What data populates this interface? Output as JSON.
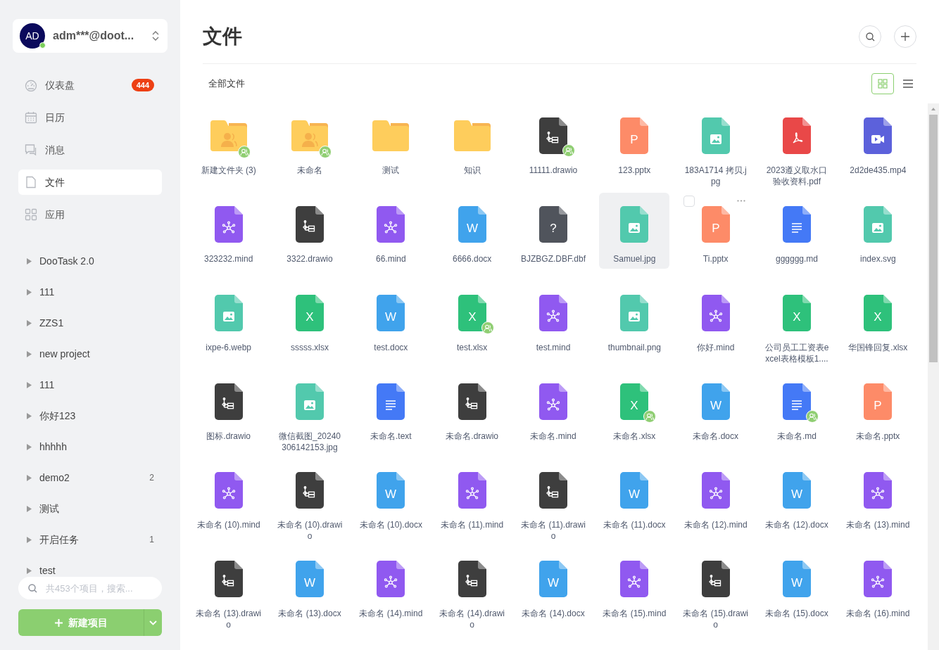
{
  "sidebar": {
    "user": {
      "avatar": "AD",
      "name": "adm***@doot...",
      "online": true
    },
    "nav": [
      {
        "kind": "dashboard",
        "label": "仪表盘",
        "badge": "444",
        "selected": false
      },
      {
        "kind": "calendar",
        "label": "日历",
        "selected": false
      },
      {
        "kind": "message",
        "label": "消息",
        "selected": false
      },
      {
        "kind": "file",
        "label": "文件",
        "selected": true
      },
      {
        "kind": "apps",
        "label": "应用",
        "selected": false
      }
    ],
    "projects": [
      {
        "name": "DooTask 2.0"
      },
      {
        "name": "111"
      },
      {
        "name": "ZZS1"
      },
      {
        "name": "new project"
      },
      {
        "name": "111"
      },
      {
        "name": "你好123"
      },
      {
        "name": "hhhhh"
      },
      {
        "name": "demo2",
        "count": "2"
      },
      {
        "name": "测试"
      },
      {
        "name": "开启任务",
        "count": "1"
      },
      {
        "name": "test"
      }
    ],
    "search": {
      "placeholder": "共453个项目，搜索..."
    },
    "new_button": "新建项目"
  },
  "main": {
    "title": "文件",
    "breadcrumb": "全部文件",
    "view_modes": [
      {
        "kind": "grid",
        "selected": true
      },
      {
        "kind": "list",
        "selected": false
      }
    ],
    "files": [
      {
        "name": "新建文件夹 (3)",
        "kind": "folder",
        "shared": true,
        "selected": false,
        "hovered": false
      },
      {
        "name": "未命名",
        "kind": "folder",
        "shared": true,
        "selected": false,
        "hovered": false
      },
      {
        "name": "测试",
        "kind": "folder",
        "shared": false,
        "selected": false,
        "hovered": false
      },
      {
        "name": "知识",
        "kind": "folder",
        "shared": false,
        "selected": false,
        "hovered": false
      },
      {
        "name": "11111.drawio",
        "kind": "drawio",
        "shared": true,
        "selected": false,
        "hovered": false
      },
      {
        "name": "123.pptx",
        "kind": "pptx",
        "glyph": "P",
        "shared": false,
        "selected": false,
        "hovered": false
      },
      {
        "name": "183A1714 拷贝.jpg",
        "kind": "image",
        "shared": false,
        "selected": false,
        "hovered": false
      },
      {
        "name": "2023遵义取水口验收资料.pdf",
        "kind": "pdf",
        "shared": false,
        "selected": false,
        "hovered": false
      },
      {
        "name": "2d2de435.mp4",
        "kind": "video",
        "shared": false,
        "selected": false,
        "hovered": false
      },
      {
        "name": "323232.mind",
        "kind": "mind",
        "shared": false,
        "selected": false,
        "hovered": false
      },
      {
        "name": "3322.drawio",
        "kind": "drawio",
        "shared": false,
        "selected": false,
        "hovered": false
      },
      {
        "name": "66.mind",
        "kind": "mind",
        "shared": false,
        "selected": false,
        "hovered": false
      },
      {
        "name": "6666.docx",
        "kind": "docx",
        "glyph": "W",
        "shared": false,
        "selected": false,
        "hovered": false
      },
      {
        "name": "BJZBGZ.DBF.dbf",
        "kind": "unknown",
        "glyph": "?",
        "shared": false,
        "selected": false,
        "hovered": false
      },
      {
        "name": "Samuel.jpg",
        "kind": "image",
        "shared": false,
        "selected": true,
        "hovered": false
      },
      {
        "name": "Ti.pptx",
        "kind": "pptx",
        "glyph": "P",
        "shared": false,
        "selected": false,
        "hovered": true
      },
      {
        "name": "gggggg.md",
        "kind": "md",
        "shared": false,
        "selected": false,
        "hovered": false
      },
      {
        "name": "index.svg",
        "kind": "image",
        "shared": false,
        "selected": false,
        "hovered": false
      },
      {
        "name": "ixpe-6.webp",
        "kind": "image",
        "shared": false,
        "selected": false,
        "hovered": false
      },
      {
        "name": "sssss.xlsx",
        "kind": "xlsx",
        "glyph": "X",
        "shared": false,
        "selected": false,
        "hovered": false
      },
      {
        "name": "test.docx",
        "kind": "docx",
        "glyph": "W",
        "shared": false,
        "selected": false,
        "hovered": false
      },
      {
        "name": "test.xlsx",
        "kind": "xlsx",
        "glyph": "X",
        "shared": true,
        "selected": false,
        "hovered": false
      },
      {
        "name": "test.mind",
        "kind": "mind",
        "shared": false,
        "selected": false,
        "hovered": false
      },
      {
        "name": "thumbnail.png",
        "kind": "image",
        "shared": false,
        "selected": false,
        "hovered": false
      },
      {
        "name": "你好.mind",
        "kind": "mind",
        "shared": false,
        "selected": false,
        "hovered": false
      },
      {
        "name": "公司员工工资表excel表格模板1....",
        "kind": "xlsx",
        "glyph": "X",
        "shared": false,
        "selected": false,
        "hovered": false
      },
      {
        "name": "华国锋回复.xlsx",
        "kind": "xlsx",
        "glyph": "X",
        "shared": false,
        "selected": false,
        "hovered": false
      },
      {
        "name": "图标.drawio",
        "kind": "drawio",
        "shared": false,
        "selected": false,
        "hovered": false
      },
      {
        "name": "微信截图_20240306142153.jpg",
        "kind": "image",
        "shared": false,
        "selected": false,
        "hovered": false
      },
      {
        "name": "未命名.text",
        "kind": "md",
        "shared": false,
        "selected": false,
        "hovered": false
      },
      {
        "name": "未命名.drawio",
        "kind": "drawio",
        "shared": false,
        "selected": false,
        "hovered": false
      },
      {
        "name": "未命名.mind",
        "kind": "mind",
        "shared": false,
        "selected": false,
        "hovered": false
      },
      {
        "name": "未命名.xlsx",
        "kind": "xlsx",
        "glyph": "X",
        "shared": true,
        "selected": false,
        "hovered": false
      },
      {
        "name": "未命名.docx",
        "kind": "docx",
        "glyph": "W",
        "shared": false,
        "selected": false,
        "hovered": false
      },
      {
        "name": "未命名.md",
        "kind": "md",
        "shared": true,
        "selected": false,
        "hovered": false
      },
      {
        "name": "未命名.pptx",
        "kind": "pptx",
        "glyph": "P",
        "shared": false,
        "selected": false,
        "hovered": false
      },
      {
        "name": "未命名 (10).mind",
        "kind": "mind",
        "shared": false,
        "selected": false,
        "hovered": false
      },
      {
        "name": "未命名 (10).drawio",
        "kind": "drawio",
        "shared": false,
        "selected": false,
        "hovered": false
      },
      {
        "name": "未命名 (10).docx",
        "kind": "docx",
        "glyph": "W",
        "shared": false,
        "selected": false,
        "hovered": false
      },
      {
        "name": "未命名 (11).mind",
        "kind": "mind",
        "shared": false,
        "selected": false,
        "hovered": false
      },
      {
        "name": "未命名 (11).drawio",
        "kind": "drawio",
        "shared": false,
        "selected": false,
        "hovered": false
      },
      {
        "name": "未命名 (11).docx",
        "kind": "docx",
        "glyph": "W",
        "shared": false,
        "selected": false,
        "hovered": false
      },
      {
        "name": "未命名 (12).mind",
        "kind": "mind",
        "shared": false,
        "selected": false,
        "hovered": false
      },
      {
        "name": "未命名 (12).docx",
        "kind": "docx",
        "glyph": "W",
        "shared": false,
        "selected": false,
        "hovered": false
      },
      {
        "name": "未命名 (13).mind",
        "kind": "mind",
        "shared": false,
        "selected": false,
        "hovered": false
      },
      {
        "name": "未命名 (13).drawio",
        "kind": "drawio",
        "shared": false,
        "selected": false,
        "hovered": false
      },
      {
        "name": "未命名 (13).docx",
        "kind": "docx",
        "glyph": "W",
        "shared": false,
        "selected": false,
        "hovered": false
      },
      {
        "name": "未命名 (14).mind",
        "kind": "mind",
        "shared": false,
        "selected": false,
        "hovered": false
      },
      {
        "name": "未命名 (14).drawio",
        "kind": "drawio",
        "shared": false,
        "selected": false,
        "hovered": false
      },
      {
        "name": "未命名 (14).docx",
        "kind": "docx",
        "glyph": "W",
        "shared": false,
        "selected": false,
        "hovered": false
      },
      {
        "name": "未命名 (15).mind",
        "kind": "mind",
        "shared": false,
        "selected": false,
        "hovered": false
      },
      {
        "name": "未命名 (15).drawio",
        "kind": "drawio",
        "shared": false,
        "selected": false,
        "hovered": false
      },
      {
        "name": "未命名 (15).docx",
        "kind": "docx",
        "glyph": "W",
        "shared": false,
        "selected": false,
        "hovered": false
      },
      {
        "name": "未命名 (16).mind",
        "kind": "mind",
        "shared": false,
        "selected": false,
        "hovered": false
      }
    ]
  }
}
